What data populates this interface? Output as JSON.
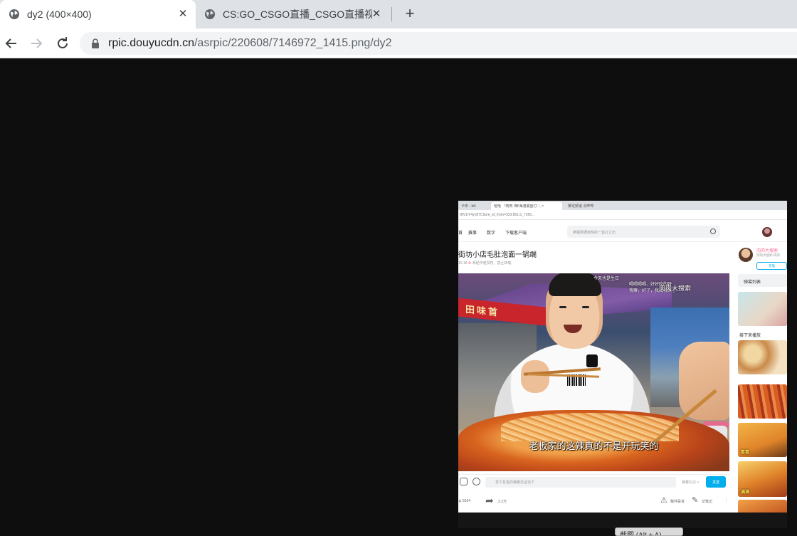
{
  "browser": {
    "tabs": [
      {
        "title": "dy2 (400×400)",
        "active": true
      },
      {
        "title": "CS:GO_CSGO直播_CSGO直播视",
        "active": false
      }
    ],
    "address": {
      "host": "rpic.douyucdn.cn",
      "path": "/asrpic/220608/7146972_1415.png/dy2"
    }
  },
  "shown_image": {
    "inner_tabs": [
      "卡布 - bili",
      "哈哈 『肉肉 !辣!海港漏宫灯..', ×",
      "推定频道 点哔哔"
    ],
    "inner_address": "/BV1iY4y187C5pre_id_from=333.851.b_7265...",
    "nav": [
      "首",
      "赛事",
      "数字",
      "下载客户端"
    ],
    "search_placeholder": "拳程数据锁热的一直打立出",
    "video_title": "街坊小店毛肚泡面一锅端",
    "video_meta": {
      "time": "15:18",
      "notice": "未经作者授权，禁止转载"
    },
    "overlay": {
      "note": "今天也是生日",
      "note2": "喝喝喝喝、好好吃的呀\n我嘛，好了，我成我来了",
      "channel": "肉肉大搜索"
    },
    "shop_sign": "田味首",
    "subtitle": "老板家的这辣真的不是开玩笑的",
    "danmaku": {
      "placeholder": "发个友善的弹幕见证当下",
      "etiquette": "弹幕礼仪 >",
      "send": "发送"
    },
    "actions": {
      "like": "8164",
      "share": "2.2万",
      "report": "稿件投诉",
      "note": "记笔记"
    },
    "right_col": {
      "up_name": "肉肉大搜索",
      "up_desc": "肉肉大搜索-肉肉",
      "follow": "充电",
      "danmaku_list": "弹幕列表",
      "autoplay_label": "接下来播放",
      "thumb_texts": [
        "",
        "",
        "",
        "看看",
        "满满",
        ""
      ]
    },
    "tooltip": "截图 (Alt + A)"
  }
}
